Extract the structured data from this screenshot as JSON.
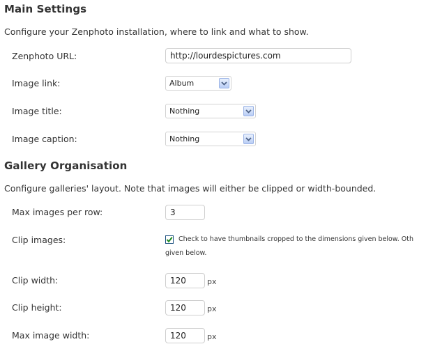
{
  "main_settings": {
    "heading": "Main Settings",
    "description": "Configure your Zenphoto installation, where to link and what to show.",
    "zenphoto_url": {
      "label": "Zenphoto URL:",
      "value": "http://lourdespictures.com"
    },
    "image_link": {
      "label": "Image link:",
      "selected": "Album"
    },
    "image_title": {
      "label": "Image title:",
      "selected": "Nothing"
    },
    "image_caption": {
      "label": "Image caption:",
      "selected": "Nothing"
    }
  },
  "gallery": {
    "heading": "Gallery Organisation",
    "description": "Configure galleries' layout. Note that images will either be clipped or width-bounded.",
    "max_per_row": {
      "label": "Max images per row:",
      "value": "3"
    },
    "clip_images": {
      "label": "Clip images:",
      "checked": true,
      "text_line1": "Check to have thumbnails cropped to the dimensions given below. Oth",
      "text_line2": "given below."
    },
    "clip_width": {
      "label": "Clip width:",
      "value": "120",
      "unit": "px"
    },
    "clip_height": {
      "label": "Clip height:",
      "value": "120",
      "unit": "px"
    },
    "max_image_width": {
      "label": "Max image width:",
      "value": "120",
      "unit": "px"
    }
  },
  "colors": {
    "checkbox_check": "#1f8a1f",
    "dropdown_arrow": "#4d6185"
  },
  "icons": {
    "dropdown": "chevron-down-icon",
    "check": "checkmark-icon"
  }
}
